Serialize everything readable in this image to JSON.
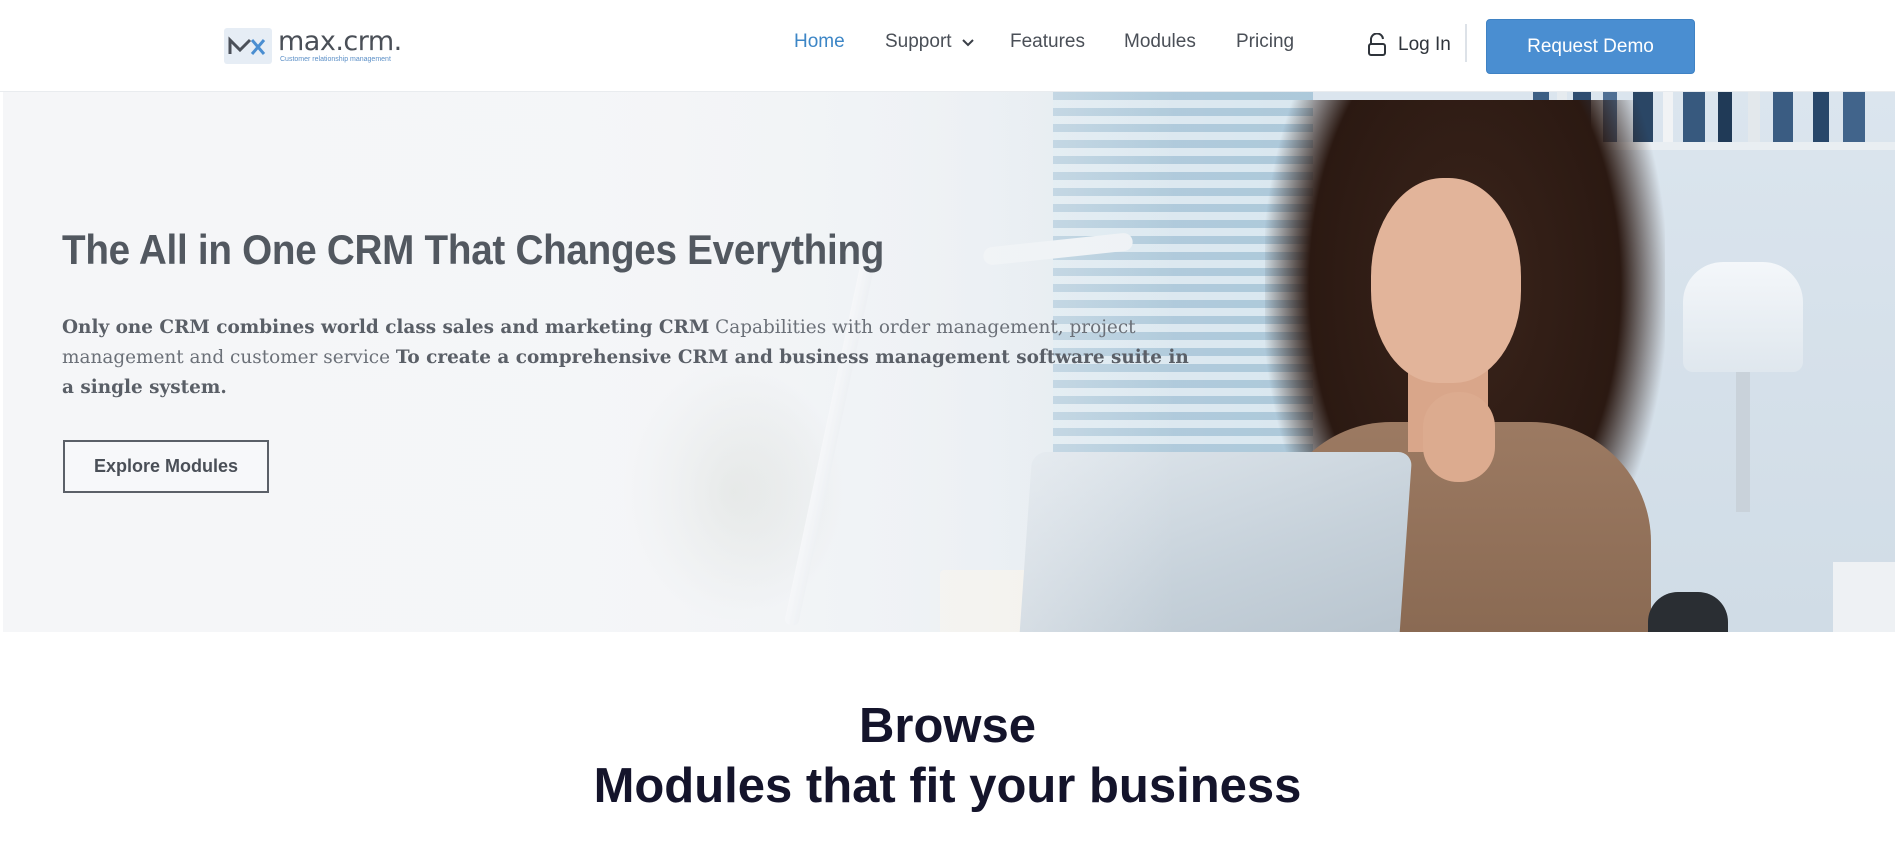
{
  "header": {
    "logo": {
      "name": "max.crm.",
      "tagline": "Customer relationship management"
    },
    "nav": [
      {
        "label": "Home",
        "active": true
      },
      {
        "label": "Support",
        "has_dropdown": true
      },
      {
        "label": "Features"
      },
      {
        "label": "Modules"
      },
      {
        "label": "Pricing"
      }
    ],
    "login_label": "Log In",
    "demo_label": "Request Demo"
  },
  "hero": {
    "title": "The All in One CRM That Changes Everything",
    "desc_bold_1": "Only one CRM combines world class sales and marketing CRM",
    "desc_plain": " Capabilities with order management, project management and customer service ",
    "desc_bold_2": "To create a comprehensive CRM and business management software suite in a single system.",
    "cta_label": "Explore Modules"
  },
  "browse": {
    "line1": "Browse",
    "line2": "Modules that fit your business"
  },
  "colors": {
    "accent": "#4a8ed1",
    "nav_active": "#3d86c6",
    "heading_dark": "#14142b",
    "hero_title": "#525860"
  },
  "icons": {
    "lock": "lock-icon",
    "chevron": "chevron-down-icon",
    "logo": "mx-logo-icon"
  }
}
